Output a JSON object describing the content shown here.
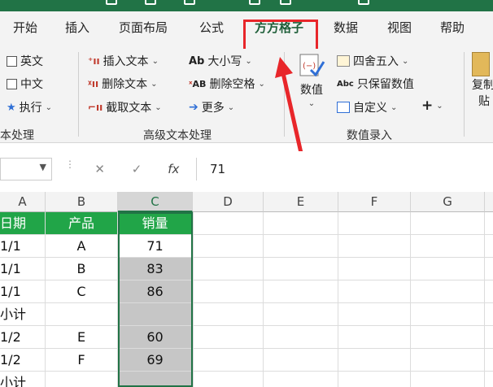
{
  "tabs": [
    "开始",
    "插入",
    "页面布局",
    "公式",
    "方方格子",
    "数据",
    "视图",
    "帮助"
  ],
  "ribbon": {
    "left_checks": [
      "英文",
      "中文"
    ],
    "execute_label": "执行",
    "group1_label": "本处理",
    "insert_text": "插入文本",
    "delete_text": "删除文本",
    "extract_text": "截取文本",
    "case_label": "大小写",
    "delete_space": "删除空格",
    "more_label": "更多",
    "group2_label": "高级文本处理",
    "value_label": "数值",
    "round_label": "四舍五入",
    "keep_value": "只保留数值",
    "custom_label": "自定义",
    "plus_label": "+",
    "group3_label": "数值录入",
    "copy_label_1": "复制",
    "copy_label_2": "贴"
  },
  "formula_bar": {
    "cancel": "✕",
    "confirm": "✓",
    "fx": "fx",
    "value": "71"
  },
  "columns": [
    "A",
    "B",
    "C",
    "D",
    "E",
    "F",
    "G"
  ],
  "rows": [
    [
      "日期",
      "产品",
      "销量"
    ],
    [
      "1/1",
      "A",
      "71"
    ],
    [
      "1/1",
      "B",
      "83"
    ],
    [
      "1/1",
      "C",
      "86"
    ],
    [
      "小计",
      "",
      ""
    ],
    [
      "1/2",
      "E",
      "60"
    ],
    [
      "1/2",
      "F",
      "69"
    ],
    [
      "小计",
      "",
      ""
    ]
  ],
  "colors": {
    "accent": "#217346",
    "header_fill": "#21a548",
    "highlight": "#e8262a"
  }
}
